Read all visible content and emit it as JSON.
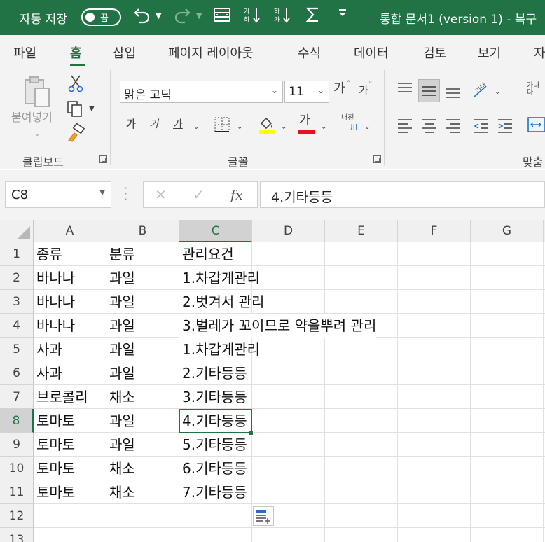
{
  "titlebar": {
    "autosave_label": "자동 저장",
    "toggle_state": "끔",
    "doc_title": "통합 문서1 (version 1)  -  복구",
    "accent_color": "#217346",
    "icons": [
      "undo-icon",
      "redo-icon",
      "form-icon",
      "sort-ascending-icon",
      "sort-descending-icon",
      "autosum-icon",
      "customize-qat-icon"
    ]
  },
  "tabs": [
    "파일",
    "홈",
    "삽입",
    "페이지 레이아웃",
    "수식",
    "데이터",
    "검토",
    "보기",
    "자"
  ],
  "active_tab": "홈",
  "ribbon": {
    "clipboard": {
      "label": "클립보드",
      "paste_label": "붙여넣기"
    },
    "font": {
      "label": "글꼴",
      "font_name": "맑은 고딕",
      "font_size": "11",
      "increase_label": "가",
      "decrease_label": "가",
      "bold": "가",
      "italic": "가",
      "underline": "가",
      "font_color_label": "가",
      "phonetic_label": "내천",
      "fill_color": "#ffff00",
      "font_color": "#e81123"
    },
    "alignment": {
      "label": "맞춤",
      "wrap_label": "가나다"
    }
  },
  "formula_bar": {
    "name_box": "C8",
    "fx_label": "fx",
    "value": "4.기타등등"
  },
  "grid": {
    "columns": [
      "A",
      "B",
      "C",
      "D",
      "E",
      "F",
      "G"
    ],
    "selected_column": "C",
    "selected_row": 8,
    "row_numbers": [
      "1",
      "2",
      "3",
      "4",
      "5",
      "6",
      "7",
      "8",
      "9",
      "10",
      "11",
      "12",
      "13"
    ],
    "rows": [
      [
        "종류",
        "분류",
        "관리요건"
      ],
      [
        "바나나",
        "과일",
        "1.차갑게관리"
      ],
      [
        "바나나",
        "과일",
        "2.벗겨서 관리"
      ],
      [
        "바나나",
        "과일",
        "3.벌레가 꼬이므로 약을뿌려 관리"
      ],
      [
        "사과",
        "과일",
        "1.차갑게관리"
      ],
      [
        "사과",
        "과일",
        "2.기타등등"
      ],
      [
        "브로콜리",
        "채소",
        "3.기타등등"
      ],
      [
        "토마토",
        "과일",
        "4.기타등등"
      ],
      [
        "토마토",
        "과일",
        "5.기타등등"
      ],
      [
        "토마토",
        "채소",
        "6.기타등등"
      ],
      [
        "토마토",
        "채소",
        "7.기타등등"
      ]
    ]
  }
}
